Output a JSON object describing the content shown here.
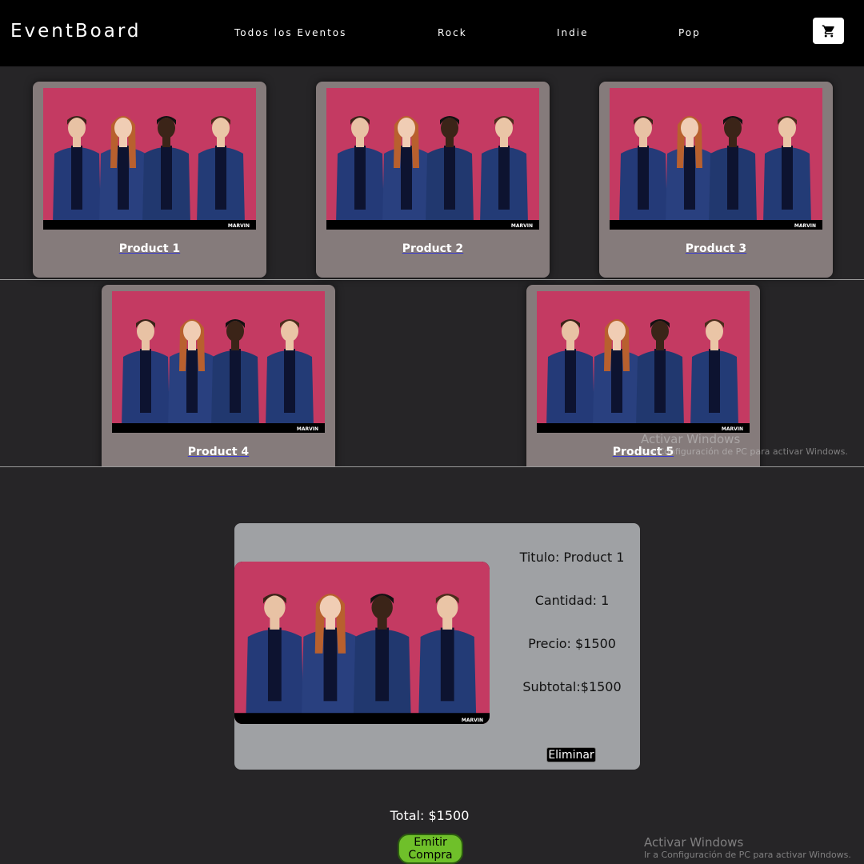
{
  "navbar": {
    "brand": "EventBoard",
    "links": [
      "Todos los Eventos",
      "Rock",
      "Indie",
      "Pop"
    ],
    "cart_icon": "shopping-cart-icon"
  },
  "products": [
    {
      "title": "Product 1",
      "badge": "MARVIN"
    },
    {
      "title": "Product 2",
      "badge": "MARVIN"
    },
    {
      "title": "Product 3",
      "badge": "MARVIN"
    },
    {
      "title": "Product 4",
      "badge": "MARVIN"
    },
    {
      "title": "Product 5",
      "badge": "MARVIN"
    }
  ],
  "cart": {
    "item": {
      "title_line": "Titulo: Product 1",
      "quantity_line": "Cantidad: 1",
      "price_line": "Precio: $1500",
      "subtotal_line": "Subtotal:$1500",
      "delete_label": "Eliminar",
      "badge": "MARVIN"
    },
    "total_line": "Total: $1500",
    "emit_label": "Emitir Compra"
  },
  "watermark": {
    "title": "Activar Windows",
    "subtitle": "Ir a Configuración de PC para activar Windows."
  },
  "colors": {
    "background": "#262527",
    "navbar": "#000000",
    "card": "#857b7b",
    "cart_card": "#9fa1a4",
    "emit_button": "#6fc02a",
    "photo_backdrop": "#c43a62"
  }
}
